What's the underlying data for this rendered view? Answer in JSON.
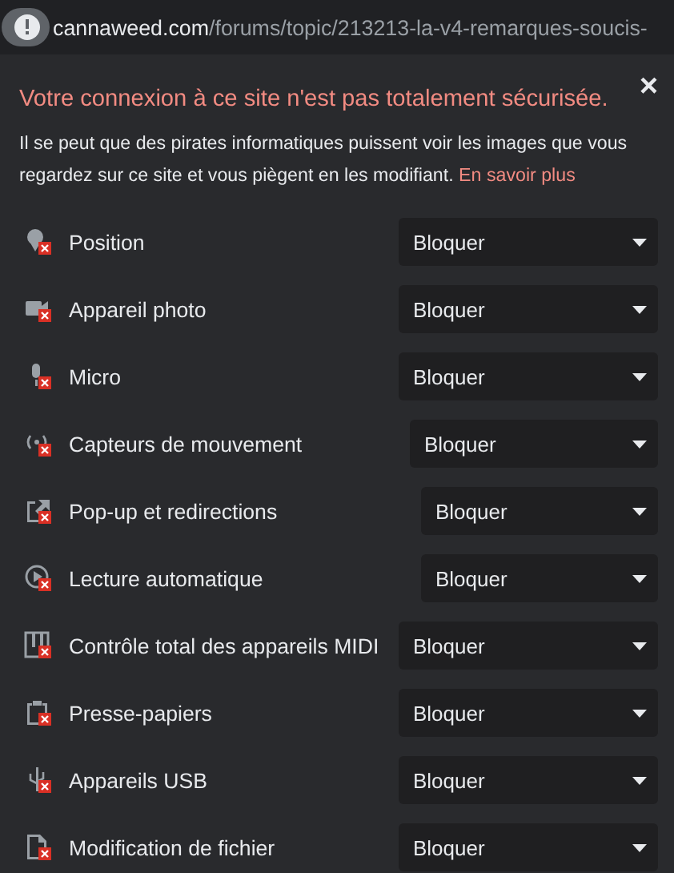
{
  "address_bar": {
    "host": "cannaweed.com",
    "path": "/forums/topic/213213-la-v4-remarques-soucis-"
  },
  "warning": {
    "title": "Votre connexion à ce site n'est pas totalement sécurisée.",
    "body": "Il se peut que des pirates informatiques puissent voir les images que vous regardez sur ce site et vous piègent en les modifiant.",
    "link": "En savoir plus",
    "close": "×"
  },
  "permissions": [
    {
      "label": "Position",
      "value": "Bloquer"
    },
    {
      "label": "Appareil photo",
      "value": "Bloquer"
    },
    {
      "label": "Micro",
      "value": "Bloquer"
    },
    {
      "label": "Capteurs de mouvement",
      "value": "Bloquer"
    },
    {
      "label": "Pop-up et redirections",
      "value": "Bloquer"
    },
    {
      "label": "Lecture automatique",
      "value": "Bloquer"
    },
    {
      "label": "Contrôle total des appareils MIDI",
      "value": "Bloquer"
    },
    {
      "label": "Presse-papiers",
      "value": "Bloquer"
    },
    {
      "label": "Appareils USB",
      "value": "Bloquer"
    },
    {
      "label": "Modification de fichier",
      "value": "Bloquer"
    }
  ]
}
